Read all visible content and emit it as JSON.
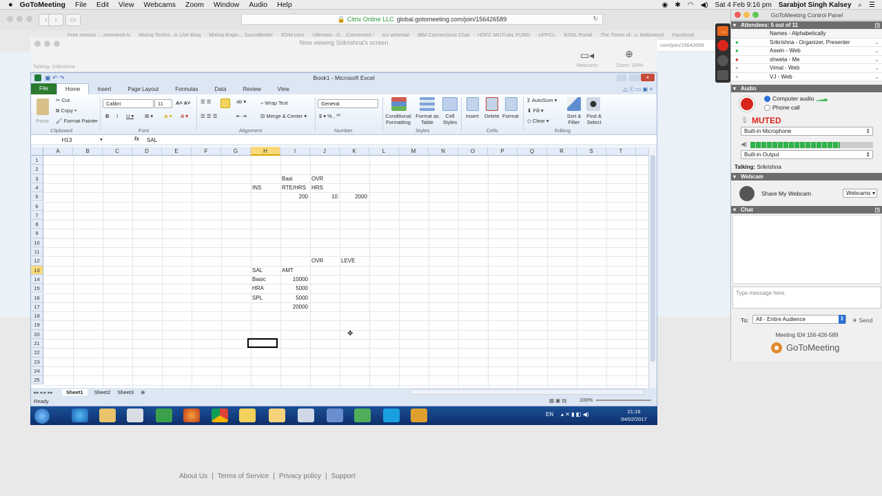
{
  "mac_menubar": {
    "app_name": "GoToMeeting",
    "menus": [
      "File",
      "Edit",
      "View",
      "Webcams",
      "Zoom",
      "Window",
      "Audio",
      "Help"
    ],
    "clock": "Sat 4 Feb  9:16 pm",
    "user": "Sarabjot Singh Kalsey"
  },
  "browser": {
    "url_site": "Citrix Online LLC",
    "url": "global.gotomeeting.com/join/156426589",
    "url_partial": "com/join/15642658",
    "bookmarks": [
      "Free movies ... xmovies8.tv",
      "Mixing Techni...ic Live Blog",
      "Mixing Engin... SoundBetter",
      "EDM.com",
      "Ultimatix - D... Connected !",
      "tcs webmail",
      "IBM Connections Chat",
      "HDFC MUTUAL FUND",
      "UPPCL",
      "BSNL Portal",
      "The Times of...s, Bollywood",
      "Facebook"
    ]
  },
  "viewer": {
    "title": "Now viewing Srikrishna's screen",
    "talking": "Talking: Srikrishna",
    "webcams_label": "Webcams",
    "zoom_label": "Zoom: 100%"
  },
  "excel": {
    "window_title": "Book1 - Microsoft Excel",
    "tabs": [
      "File",
      "Home",
      "Insert",
      "Page Layout",
      "Formulas",
      "Data",
      "Review",
      "View"
    ],
    "ribbon": {
      "clipboard": {
        "paste": "Paste",
        "cut": "Cut",
        "copy": "Copy",
        "format_painter": "Format Painter",
        "label": "Clipboard"
      },
      "font": {
        "name": "Calibri",
        "size": "11",
        "label": "Font"
      },
      "alignment": {
        "wrap": "Wrap Text",
        "merge": "Merge & Center",
        "label": "Alignment"
      },
      "number": {
        "format": "General",
        "label": "Number"
      },
      "styles": {
        "conditional": "Conditional Formatting",
        "as_table": "Format as Table",
        "cell_styles": "Cell Styles",
        "label": "Styles"
      },
      "cells": {
        "insert": "Insert",
        "delete": "Delete",
        "format": "Format",
        "label": "Cells"
      },
      "editing": {
        "autosum": "AutoSum",
        "fill": "Fill",
        "clear": "Clear",
        "sort": "Sort & Filter",
        "find": "Find & Select",
        "label": "Editing"
      }
    },
    "name_box": "H13",
    "formula": "SAL",
    "columns": [
      "A",
      "B",
      "C",
      "D",
      "E",
      "F",
      "G",
      "H",
      "I",
      "J",
      "K",
      "L",
      "M",
      "N",
      "O",
      "P",
      "Q",
      "R",
      "S",
      "T",
      "U"
    ],
    "rows": [
      "1",
      "2",
      "3",
      "4",
      "5",
      "6",
      "7",
      "8",
      "9",
      "10",
      "11",
      "12",
      "13",
      "14",
      "15",
      "16",
      "17",
      "18",
      "19",
      "20",
      "21",
      "22",
      "23",
      "24",
      "25"
    ],
    "cells": {
      "I3": "Basi",
      "J3": "OVR",
      "H4": "INS",
      "I4": "RTE/HRS",
      "J4": "HRS",
      "I5": "200",
      "J5": "10",
      "K5": "2000",
      "J12": "OVR",
      "K12": "LEVE",
      "H13": "SAL",
      "I13": "AMT",
      "H14": "Basic",
      "I14": "10000",
      "H15": "HRA",
      "I15": "5000",
      "H16": "SPL",
      "I16": "5000",
      "I17": "20000"
    },
    "sheets": [
      "Sheet1",
      "Sheet2",
      "Sheet3"
    ],
    "status": "Ready",
    "zoom": "100%"
  },
  "taskbar": {
    "lang": "EN",
    "time": "21:16",
    "date": "04/02/2017"
  },
  "footer_links": [
    "About Us",
    "Terms of Service",
    "Privacy policy",
    "Support"
  ],
  "panel": {
    "title": "GoToMeeting Control Panel",
    "attendees_header": "Attendees: 5 out of 11",
    "names_header": "Names - Alphabetically",
    "attendees": [
      "Srikrishna - Organizer, Presenter",
      "Aswin - Web",
      "shweta - Me",
      "Vimal - Web",
      "VJ - Web"
    ],
    "audio_header": "Audio",
    "computer_audio": "Computer audio",
    "phone_call": "Phone call",
    "muted": "MUTED",
    "mic_device": "Built-in Microphone",
    "speaker_level": 0.73,
    "output_device": "Built-in Output",
    "talking": "Talking:",
    "talking_name": "Srikrishna",
    "webcam_header": "Webcam",
    "share_webcam": "Share My Webcam",
    "webcams_select": "Webcams",
    "chat_header": "Chat",
    "chat_placeholder": "Type message here.",
    "to_label": "To:",
    "to_value": "All - Entire Audience",
    "send": "Send",
    "meeting_id": "Meeting ID# 156-426-589",
    "brand": "GoToMeeting"
  },
  "colors": {
    "excel_green": "#2b7a2e",
    "muted_red": "#d9261c",
    "level_green": "#2fb24a"
  }
}
